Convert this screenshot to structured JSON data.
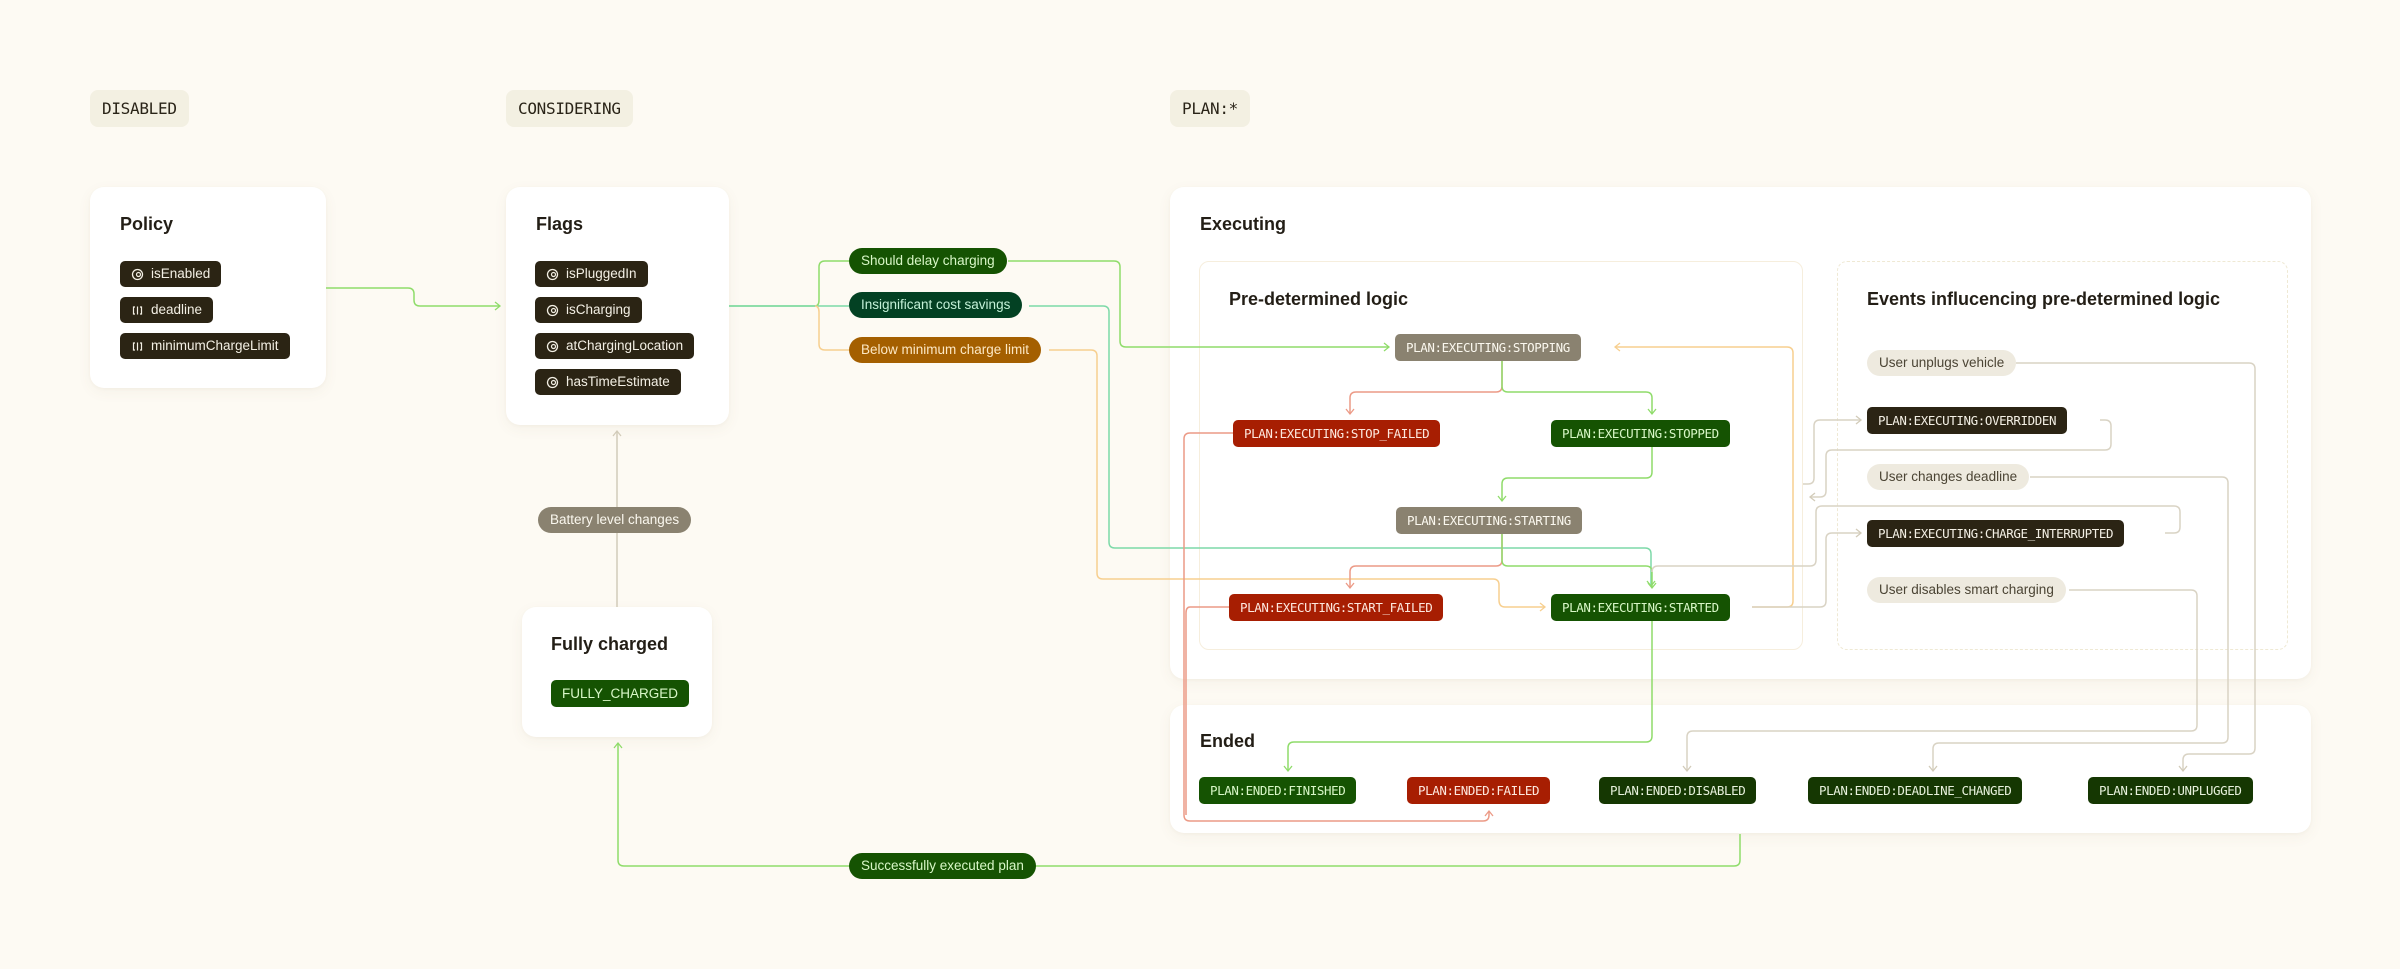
{
  "sections": {
    "disabled": "DISABLED",
    "considering": "CONSIDERING",
    "plan": "PLAN:*"
  },
  "policy": {
    "title": "Policy",
    "items": [
      {
        "label": "isEnabled",
        "icon": "toggle-icon"
      },
      {
        "label": "deadline",
        "icon": "input-field-icon"
      },
      {
        "label": "minimumChargeLimit",
        "icon": "input-field-icon"
      }
    ]
  },
  "flags": {
    "title": "Flags",
    "items": [
      {
        "label": "isPluggedIn",
        "icon": "toggle-icon"
      },
      {
        "label": "isCharging",
        "icon": "toggle-icon"
      },
      {
        "label": "atChargingLocation",
        "icon": "toggle-icon"
      },
      {
        "label": "hasTimeEstimate",
        "icon": "toggle-icon"
      }
    ]
  },
  "fully_charged": {
    "title": "Fully charged",
    "state": "FULLY_CHARGED"
  },
  "transitions": {
    "should_delay": "Should delay charging",
    "insignificant_savings": "Insignificant cost savings",
    "below_min": "Below minimum charge limit",
    "battery_changes": "Battery level changes",
    "success": "Successfully executed plan"
  },
  "executing": {
    "title": "Executing",
    "predetermined": {
      "title": "Pre-determined logic",
      "states": {
        "stopping": "PLAN:EXECUTING:STOPPING",
        "stop_failed": "PLAN:EXECUTING:STOP_FAILED",
        "stopped": "PLAN:EXECUTING:STOPPED",
        "starting": "PLAN:EXECUTING:STARTING",
        "start_failed": "PLAN:EXECUTING:START_FAILED",
        "started": "PLAN:EXECUTING:STARTED"
      }
    },
    "events": {
      "title": "Events influcencing pre-determined logic",
      "unplugs": "User unplugs vehicle",
      "overridden": "PLAN:EXECUTING:OVERRIDDEN",
      "changes_deadline": "User changes deadline",
      "charge_interrupted": "PLAN:EXECUTING:CHARGE_INTERRUPTED",
      "disables_smart": "User disables smart charging"
    }
  },
  "ended": {
    "title": "Ended",
    "states": {
      "finished": "PLAN:ENDED:FINISHED",
      "failed": "PLAN:ENDED:FAILED",
      "disabled": "PLAN:ENDED:DISABLED",
      "deadline_changed": "PLAN:ENDED:DEADLINE_CHANGED",
      "unplugged": "PLAN:ENDED:UNPLUGGED"
    }
  },
  "colors": {
    "background": "#fdfaf3",
    "success_wire": "#8fdc6a",
    "teal_wire": "#7dd9a8",
    "orange_wire": "#f7cf8f",
    "red_wire": "#ec9a86",
    "neutral_wire": "#d9d3c4",
    "state_green": "#155302",
    "state_red": "#a71e02",
    "state_gray": "#8a8270",
    "state_dark": "#2b2414",
    "pill_orange": "#a45f00",
    "pill_teal": "#034123"
  }
}
